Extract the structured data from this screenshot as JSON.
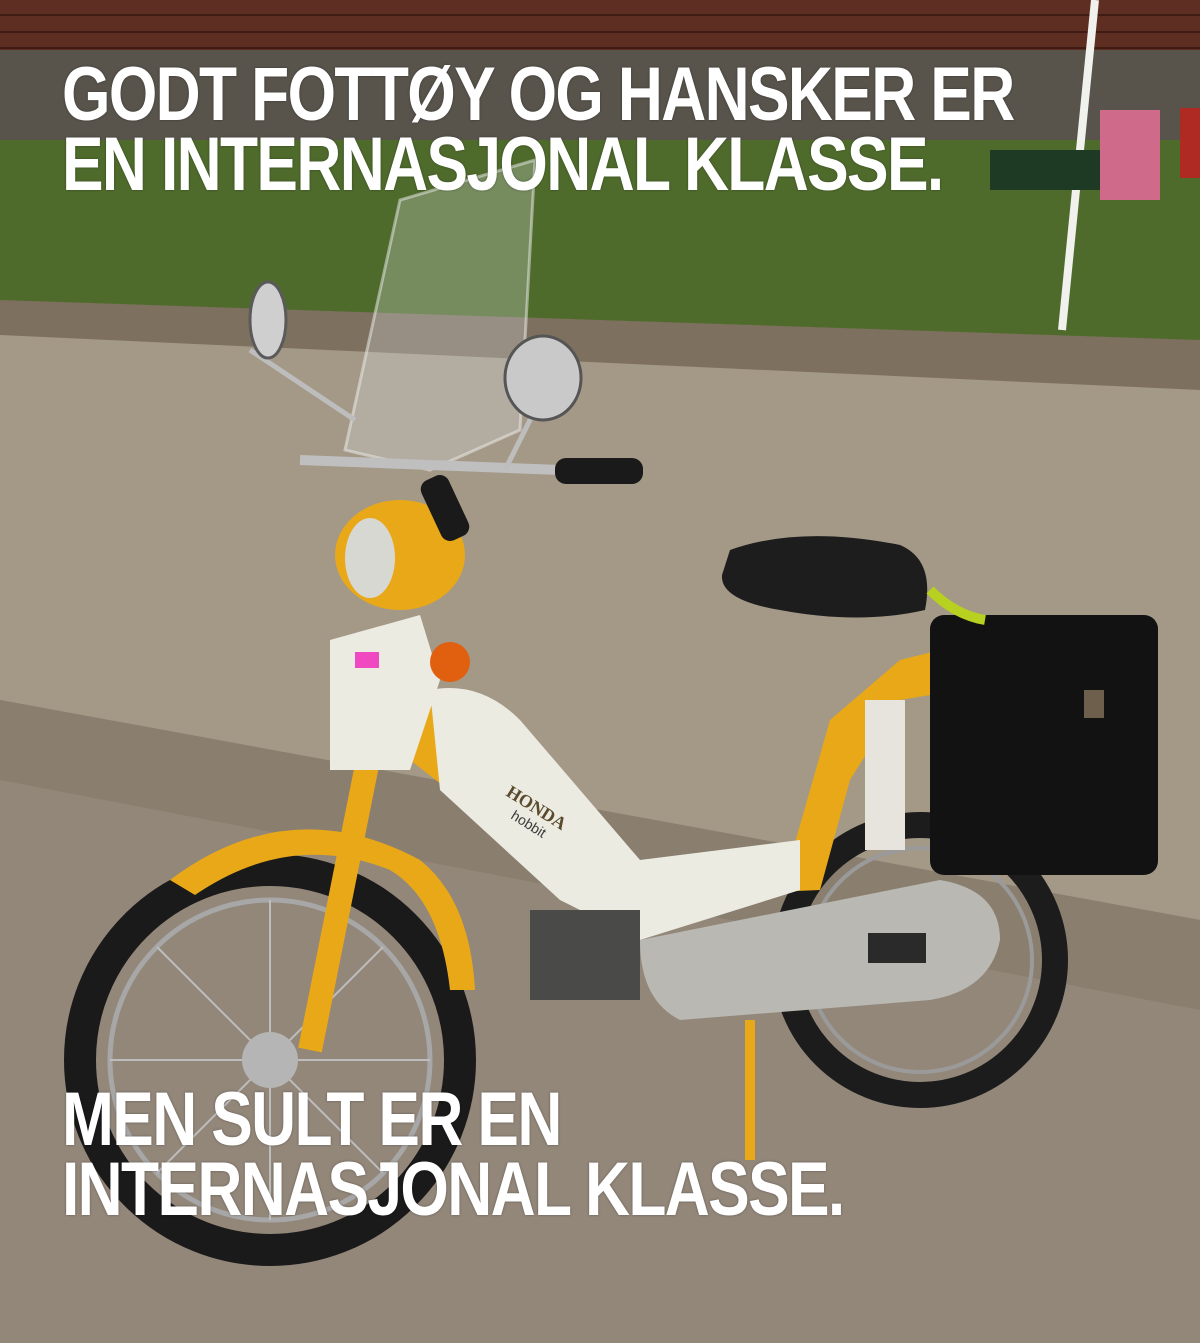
{
  "meme": {
    "top_text": {
      "line1": "GODT FOTTØY OG HANSKER ER",
      "line2": "EN INTERNASJONAL KLASSE."
    },
    "bottom_text": {
      "line1": "MEN SULT ER EN",
      "line2": "INTERNASJONAL KLASSE."
    },
    "text_color": "#ffffff"
  },
  "photo": {
    "bike_badge": "HONDA",
    "bike_model": "hobbit",
    "colors": {
      "bike_body": "#e8a818",
      "bike_panel": "#ecebe2",
      "wall": "#5e2e22",
      "grass": "#4f6b2c",
      "pavement": "#9b8e7e"
    }
  }
}
